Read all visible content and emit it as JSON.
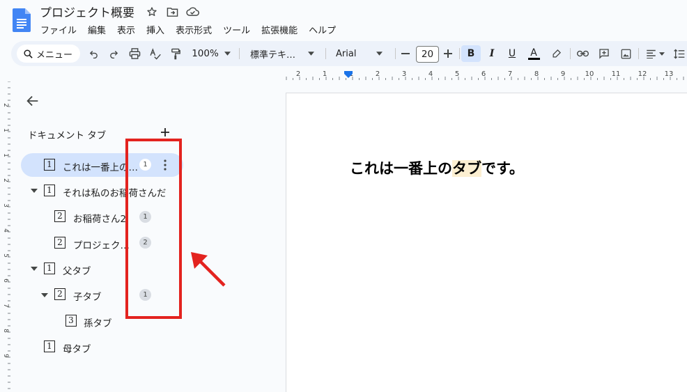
{
  "app": {
    "title": "プロジェクト概要",
    "menu": [
      "ファイル",
      "編集",
      "表示",
      "挿入",
      "表示形式",
      "ツール",
      "拡張機能",
      "ヘルプ"
    ]
  },
  "toolbar": {
    "search_label": "メニュー",
    "zoom": "100%",
    "style": "標準テキ…",
    "font": "Arial",
    "font_size": "20",
    "bold": "B",
    "italic": "I",
    "underline": "U",
    "text_color": "A"
  },
  "ruler": {
    "top_ticks": [
      "2",
      "1",
      "1",
      "2",
      "3",
      "4",
      "5",
      "6",
      "7",
      "8",
      "9",
      "10",
      "11",
      "12",
      "13"
    ],
    "left_ticks": [
      "2",
      "1",
      "1",
      "2",
      "3",
      "4",
      "5",
      "6",
      "7",
      "8",
      "9"
    ]
  },
  "sidebar": {
    "heading": "ドキュメント タブ",
    "tabs": [
      {
        "label": "これは一番上の…",
        "level_icon": "1",
        "badge": "1",
        "selected": true
      },
      {
        "label": "それは私のお稲荷さんだ",
        "level_icon": "1",
        "badge": "",
        "expanded": true
      },
      {
        "label": "お稲荷さん2",
        "level_icon": "2",
        "badge": "1"
      },
      {
        "label": "プロジェク…",
        "level_icon": "2",
        "badge": "2"
      },
      {
        "label": "父タブ",
        "level_icon": "1",
        "badge": "",
        "expanded": true
      },
      {
        "label": "子タブ",
        "level_icon": "2",
        "badge": "1",
        "expanded": true
      },
      {
        "label": "孫タブ",
        "level_icon": "3",
        "badge": ""
      },
      {
        "label": "母タブ",
        "level_icon": "1",
        "badge": ""
      }
    ]
  },
  "document": {
    "heading_before": "これは一番上の",
    "heading_highlight": "タブ",
    "heading_after": "です。"
  },
  "colors": {
    "accent": "#1a73e8",
    "selected_tab_bg": "#d3e3fd",
    "toolbar_bg": "#edf2fa",
    "annotation_red": "#e3231f",
    "highlight": "#fcefd1"
  }
}
